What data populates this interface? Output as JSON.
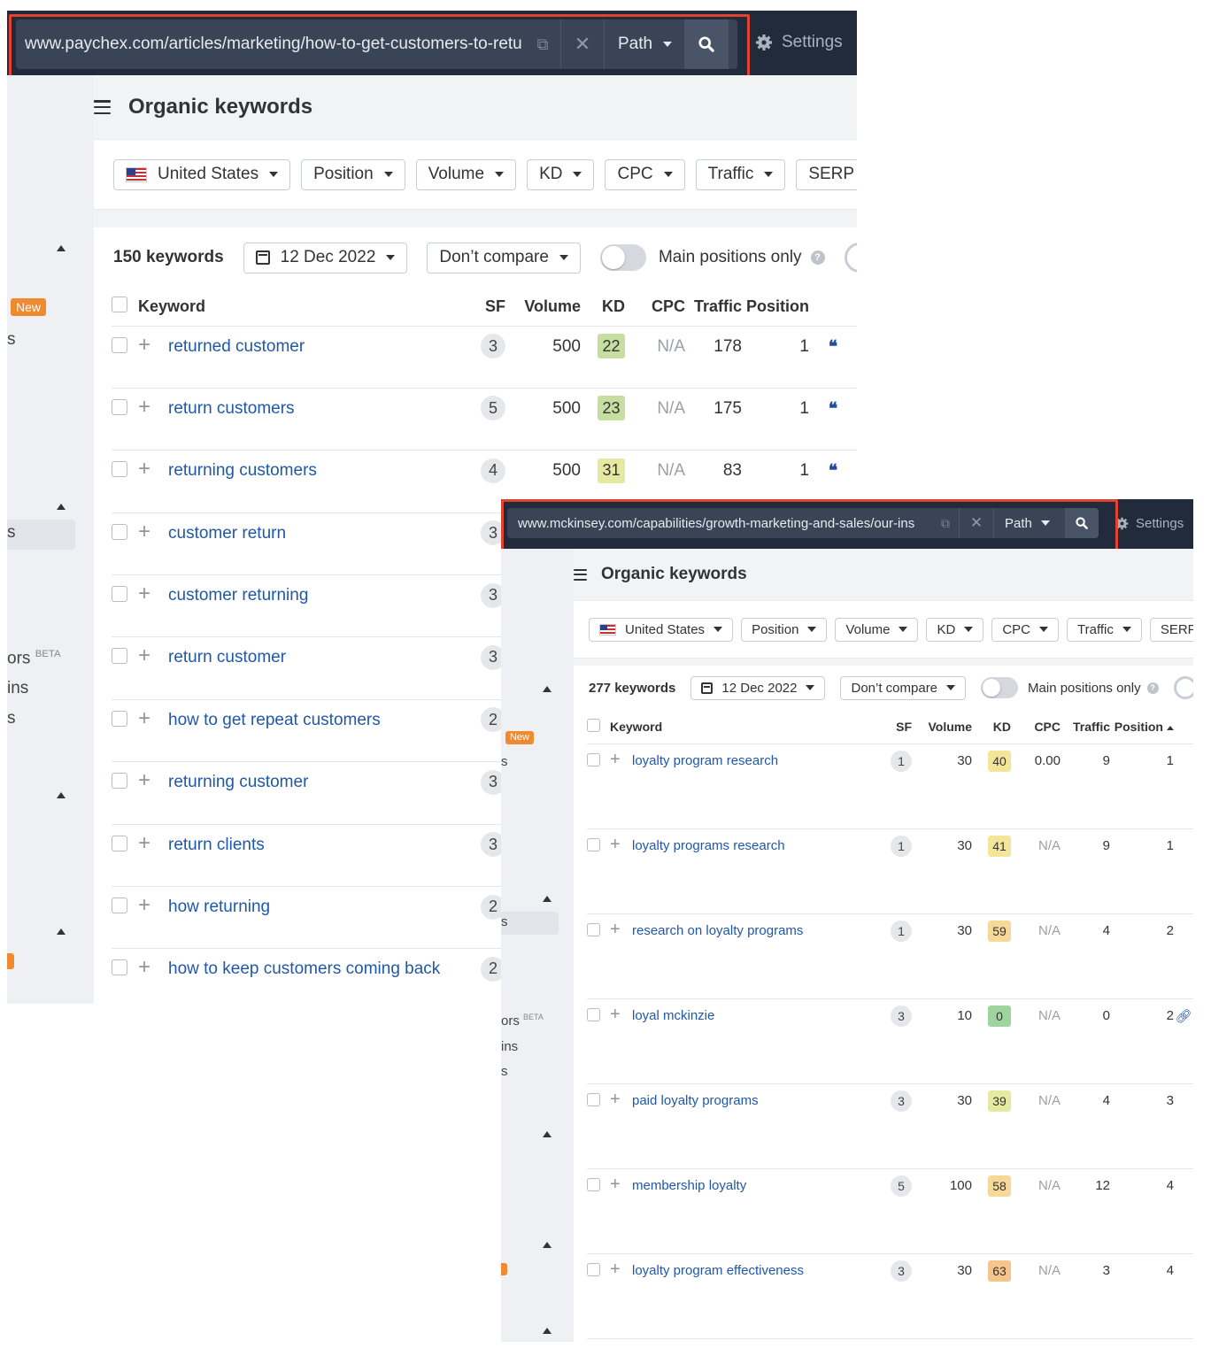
{
  "colors": {
    "topbar_bg": "#222b3c",
    "highlight_border": "#e0432f",
    "link": "#2058a8",
    "kd_green": "#c7dea1",
    "kd_yellow_green": "#dce7a1",
    "kd_yellow": "#f3e69a",
    "kd_light_orange": "#f6d898",
    "kd_orange": "#f5c58c",
    "kd_dark_green": "#9fd49f",
    "new_badge": "#f08a30"
  },
  "screenshot1": {
    "url": "www.paychex.com/articles/marketing/how-to-get-customers-to-retu",
    "path_label": "Path",
    "settings_label": "Settings",
    "page_title": "Organic keywords",
    "filters": {
      "country": "United States",
      "position": "Position",
      "volume": "Volume",
      "kd": "KD",
      "cpc": "CPC",
      "traffic": "Traffic",
      "serp": "SERP f"
    },
    "keyword_count": "150 keywords",
    "date": "12 Dec 2022",
    "compare": "Don’t compare",
    "main_positions_label": "Main positions only",
    "sidebar_fragments": {
      "new_badge": "New",
      "s1": "s",
      "s2": "s",
      "ors": "ors",
      "beta": "BETA",
      "ins": "ins",
      "s3": "s"
    },
    "columns": {
      "keyword": "Keyword",
      "sf": "SF",
      "volume": "Volume",
      "kd": "KD",
      "cpc": "CPC",
      "traffic": "Traffic",
      "position": "Position"
    },
    "rows": [
      {
        "keyword": "returned customer",
        "sf": "3",
        "volume": "500",
        "kd": "22",
        "kd_color": "#c7dea1",
        "cpc": "N/A",
        "traffic": "178",
        "position": "1",
        "icon": "quote-icon"
      },
      {
        "keyword": "return customers",
        "sf": "5",
        "volume": "500",
        "kd": "23",
        "kd_color": "#c7dea1",
        "cpc": "N/A",
        "traffic": "175",
        "position": "1",
        "icon": "quote-icon"
      },
      {
        "keyword": "returning customers",
        "sf": "4",
        "volume": "500",
        "kd": "31",
        "kd_color": "#e6e9a0",
        "cpc": "N/A",
        "traffic": "83",
        "position": "1",
        "icon": "quote-icon"
      },
      {
        "keyword": "customer return",
        "sf": "3"
      },
      {
        "keyword": "customer returning",
        "sf": "3"
      },
      {
        "keyword": "return customer",
        "sf": "3"
      },
      {
        "keyword": "how to get repeat customers",
        "sf": "2"
      },
      {
        "keyword": "returning customer",
        "sf": "3"
      },
      {
        "keyword": "return clients",
        "sf": "3"
      },
      {
        "keyword": "how returning",
        "sf": "2"
      },
      {
        "keyword": "how to keep customers coming back",
        "sf": "2"
      }
    ]
  },
  "screenshot2": {
    "url": "www.mckinsey.com/capabilities/growth-marketing-and-sales/our-ins",
    "path_label": "Path",
    "settings_label": "Settings",
    "page_title": "Organic keywords",
    "filters": {
      "country": "United States",
      "position": "Position",
      "volume": "Volume",
      "kd": "KD",
      "cpc": "CPC",
      "traffic": "Traffic",
      "serp": "SERP"
    },
    "keyword_count": "277 keywords",
    "date": "12 Dec 2022",
    "compare": "Don’t compare",
    "main_positions_label": "Main positions only",
    "sidebar_fragments": {
      "new_badge": "New",
      "s1": "s",
      "s2": "s",
      "ors": "ors",
      "beta": "BETA",
      "ins": "ins",
      "s3": "s"
    },
    "columns": {
      "keyword": "Keyword",
      "sf": "SF",
      "volume": "Volume",
      "kd": "KD",
      "cpc": "CPC",
      "traffic": "Traffic",
      "position": "Position"
    },
    "rows": [
      {
        "keyword": "loyalty program research",
        "sf": "1",
        "volume": "30",
        "kd": "40",
        "kd_color": "#f3e69a",
        "cpc": "0.00",
        "traffic": "9",
        "position": "1"
      },
      {
        "keyword": "loyalty programs research",
        "sf": "1",
        "volume": "30",
        "kd": "41",
        "kd_color": "#f3e69a",
        "cpc": "N/A",
        "traffic": "9",
        "position": "1"
      },
      {
        "keyword": "research on loyalty programs",
        "sf": "1",
        "volume": "30",
        "kd": "59",
        "kd_color": "#f6d898",
        "cpc": "N/A",
        "traffic": "4",
        "position": "2"
      },
      {
        "keyword": "loyal mckinzie",
        "sf": "3",
        "volume": "10",
        "kd": "0",
        "kd_color": "#9fd49f",
        "cpc": "N/A",
        "traffic": "0",
        "position": "2",
        "icon": "link-icon"
      },
      {
        "keyword": "paid loyalty programs",
        "sf": "3",
        "volume": "30",
        "kd": "39",
        "kd_color": "#e6e9a0",
        "cpc": "N/A",
        "traffic": "4",
        "position": "3"
      },
      {
        "keyword": "membership loyalty",
        "sf": "5",
        "volume": "100",
        "kd": "58",
        "kd_color": "#f6d898",
        "cpc": "N/A",
        "traffic": "12",
        "position": "4"
      },
      {
        "keyword": "loyalty program effectiveness",
        "sf": "3",
        "volume": "30",
        "kd": "63",
        "kd_color": "#f5c58c",
        "cpc": "N/A",
        "traffic": "3",
        "position": "4"
      }
    ]
  }
}
